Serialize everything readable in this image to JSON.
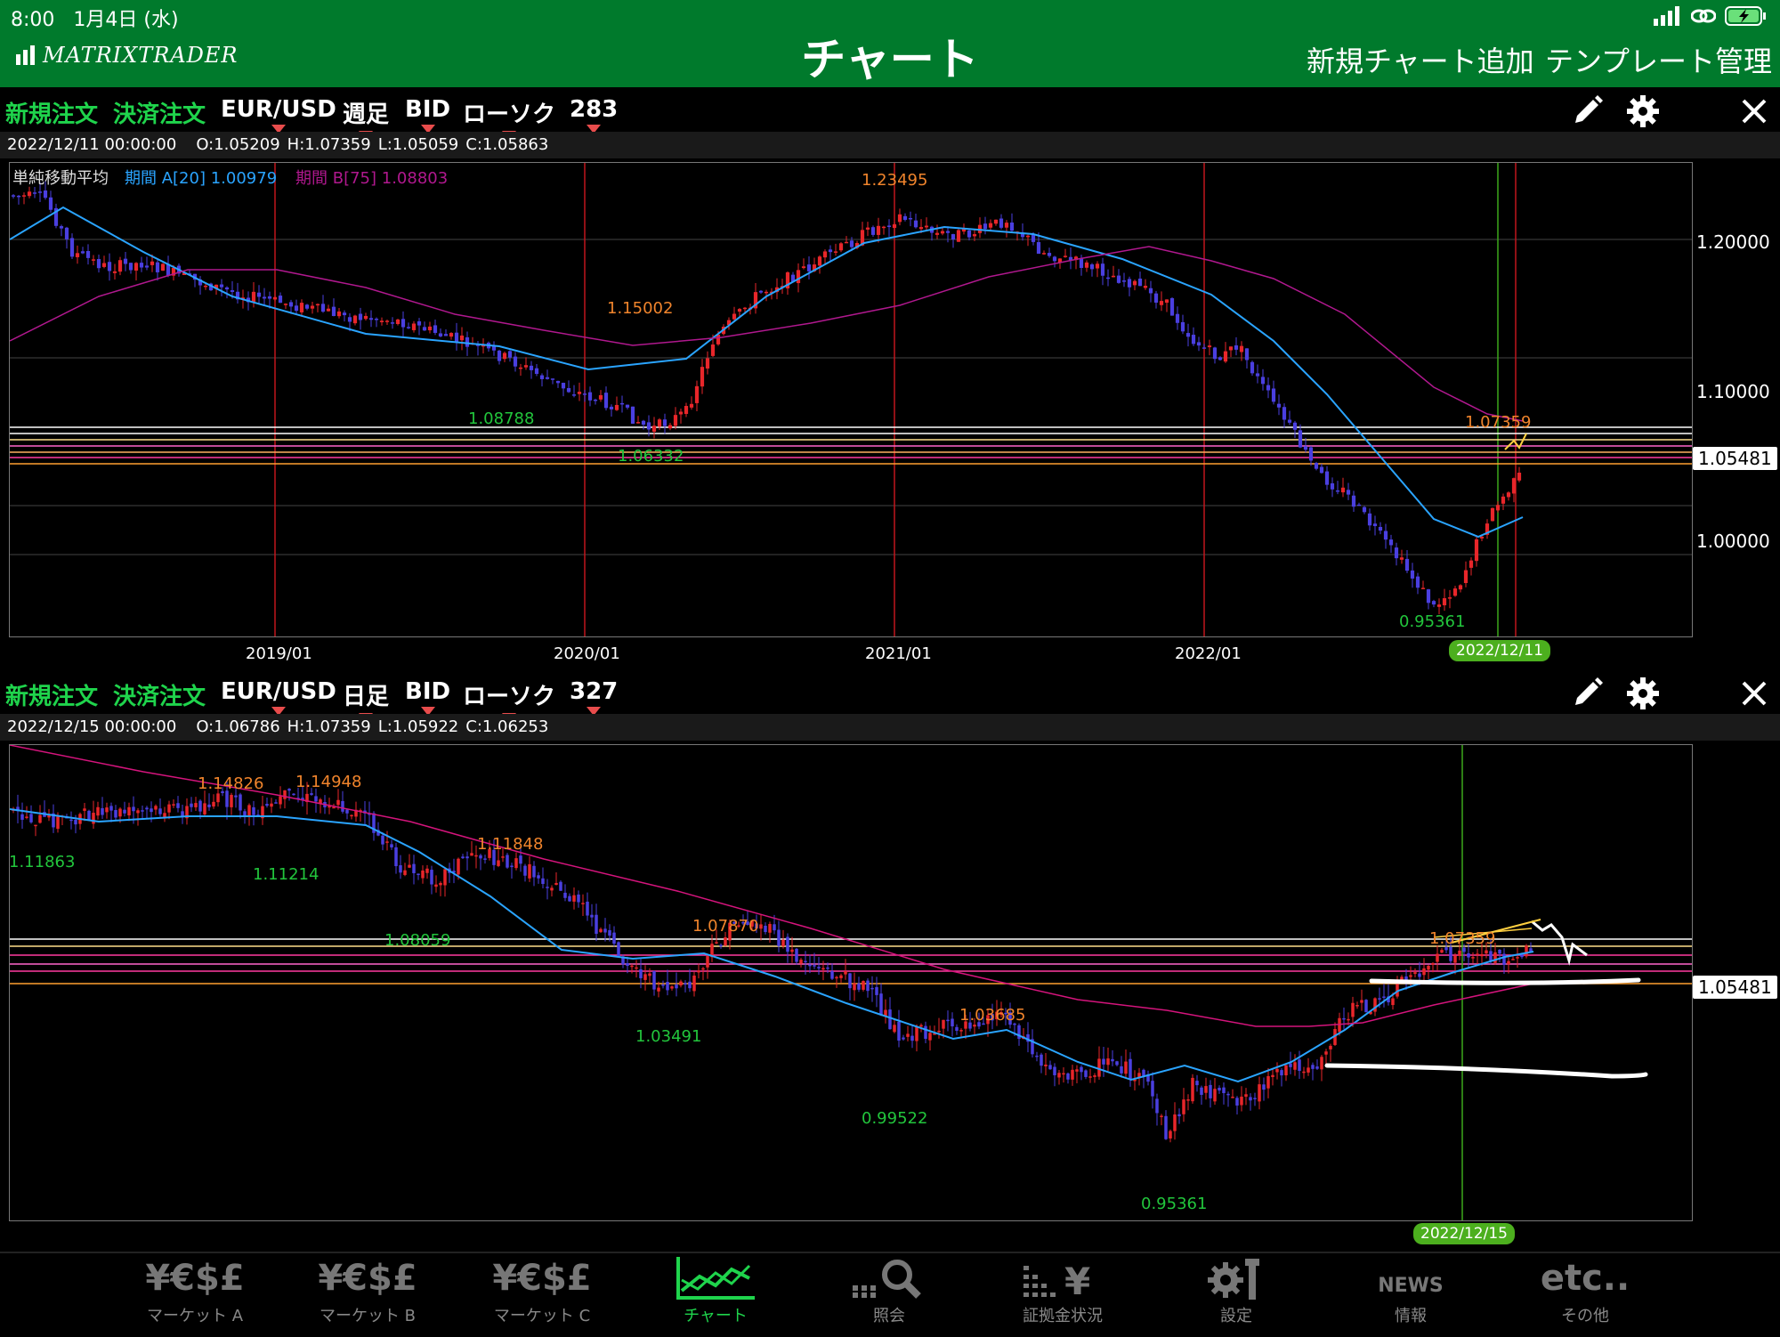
{
  "status": {
    "time": "8:00",
    "date": "1月4日 (水)"
  },
  "nav": {
    "logo": "MATRIXTRADER",
    "title": "チャート",
    "add_chart": "新規チャート追加",
    "template": "テンプレート管理"
  },
  "panels": [
    {
      "new_order": "新規注文",
      "close_order": "決済注文",
      "pair": "EUR/USD",
      "timeframe": "週足",
      "price_type": "BID",
      "chart_style": "ローソク",
      "count": "283",
      "ohlc": {
        "date": "2022/12/11 00:00:00",
        "o": "O:1.05209",
        "h": "H:1.07359",
        "l": "L:1.05059",
        "c": "C:1.05863"
      },
      "indicator": {
        "name": "単純移動平均",
        "a": "期間 A[20] 1.00979",
        "b": "期間 B[75] 1.08803"
      },
      "y_ticks": [
        "1.20000",
        "1.10000",
        "1.00000"
      ],
      "x_ticks": [
        "2019/01",
        "2020/01",
        "2021/01",
        "2022/01"
      ],
      "price_tag": "1.05481",
      "date_tag": "2022/12/11",
      "highs": [
        "1.23495",
        "1.15002",
        "1.07359"
      ],
      "lows": [
        "1.08788",
        "1.06332",
        "0.95361"
      ]
    },
    {
      "new_order": "新規注文",
      "close_order": "決済注文",
      "pair": "EUR/USD",
      "timeframe": "日足",
      "price_type": "BID",
      "chart_style": "ローソク",
      "count": "327",
      "ohlc": {
        "date": "2022/12/15 00:00:00",
        "o": "O:1.06786",
        "h": "H:1.07359",
        "l": "L:1.05922",
        "c": "C:1.06253"
      },
      "price_tag": "1.05481",
      "date_tag": "2022/12/15",
      "highs": [
        "1.14826",
        "1.14948",
        "1.11848",
        "1.07870",
        "1.03685",
        "1.07359"
      ],
      "lows": [
        "1.11863",
        "1.11214",
        "1.08059",
        "1.03491",
        "0.99522",
        "0.95361"
      ]
    }
  ],
  "tabs": [
    {
      "icon": "¥€$£",
      "label": "マーケット A"
    },
    {
      "icon": "¥€$£",
      "label": "マーケット B"
    },
    {
      "icon": "¥€$£",
      "label": "マーケット C"
    },
    {
      "icon": "chart-icon",
      "label": "チャート"
    },
    {
      "icon": "search-icon",
      "label": "照会"
    },
    {
      "icon": "margin-icon",
      "label": "証拠金状況"
    },
    {
      "icon": "gear-icon",
      "label": "設定"
    },
    {
      "icon": "NEWS",
      "label": "情報"
    },
    {
      "icon": "etc..",
      "label": "その他"
    }
  ],
  "colors": {
    "nav_green": "#007a2c",
    "accent_green": "#1fd44c",
    "up_candle": "#e8262a",
    "down_candle": "#4a3fe0",
    "ma_a": "#2aa4ff",
    "ma_b": "#b0188e"
  }
}
